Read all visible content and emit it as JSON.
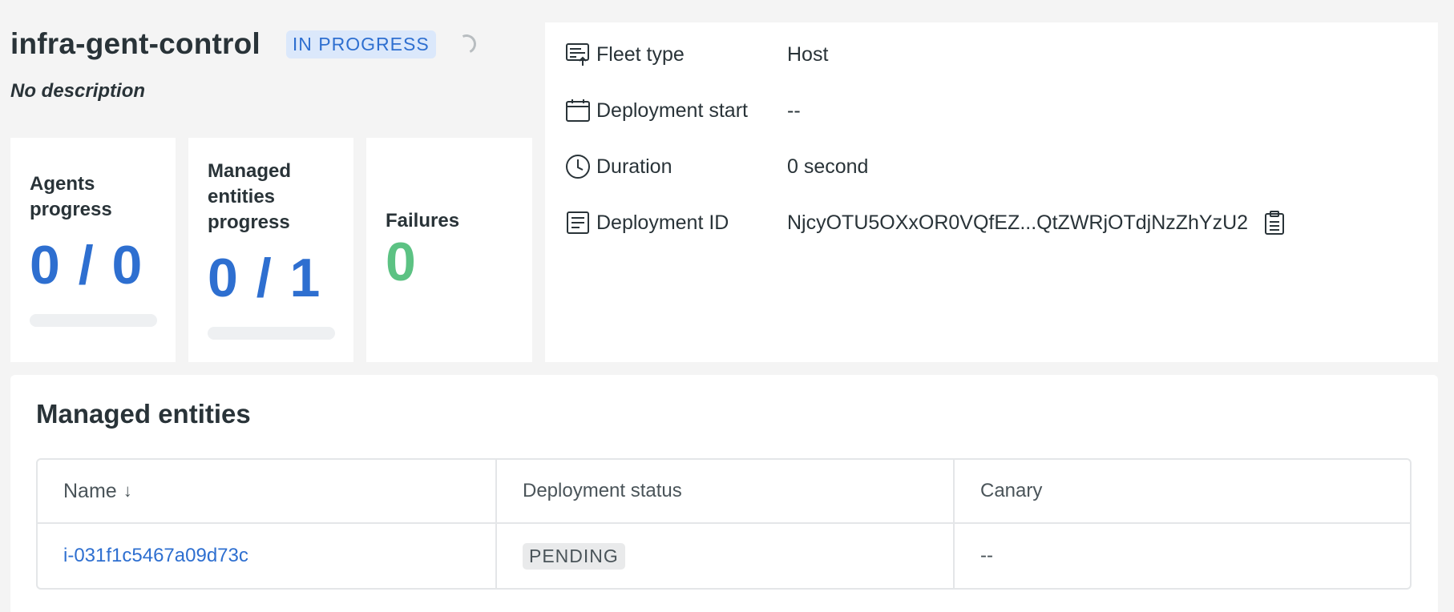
{
  "header": {
    "title": "infra-gent-control",
    "status": "IN PROGRESS",
    "description": "No description"
  },
  "stats": {
    "agents": {
      "label_line1": "Agents",
      "label_line2": "progress",
      "value": "0 / 0",
      "progress": 0
    },
    "managed": {
      "label_line1": "Managed",
      "label_line2": "entities",
      "label_line3": "progress",
      "value": "0 / 1",
      "progress": 0
    },
    "failures": {
      "label": "Failures",
      "value": "0"
    }
  },
  "details": {
    "fleet_type": {
      "label": "Fleet type",
      "value": "Host",
      "icon": "fleet-icon"
    },
    "deployment_start": {
      "label": "Deployment start",
      "value": "--",
      "icon": "calendar-icon"
    },
    "duration": {
      "label": "Duration",
      "value": "0 second",
      "icon": "clock-icon"
    },
    "deployment_id": {
      "label": "Deployment ID",
      "value": "NjcyOTU5OXxOR0VQfEZ...QtZWRjOTdjNzZhYzU2",
      "icon": "document-icon"
    }
  },
  "entities": {
    "title": "Managed entities",
    "columns": [
      "Name",
      "Deployment status",
      "Canary"
    ],
    "sort_indicator": "↓",
    "rows": [
      {
        "name": "i-031f1c5467a09d73c",
        "status": "PENDING",
        "canary": "--"
      }
    ]
  },
  "colors": {
    "accent": "#2e6fd0",
    "success": "#5cc283",
    "pill_bg": "#dbe8fb"
  }
}
